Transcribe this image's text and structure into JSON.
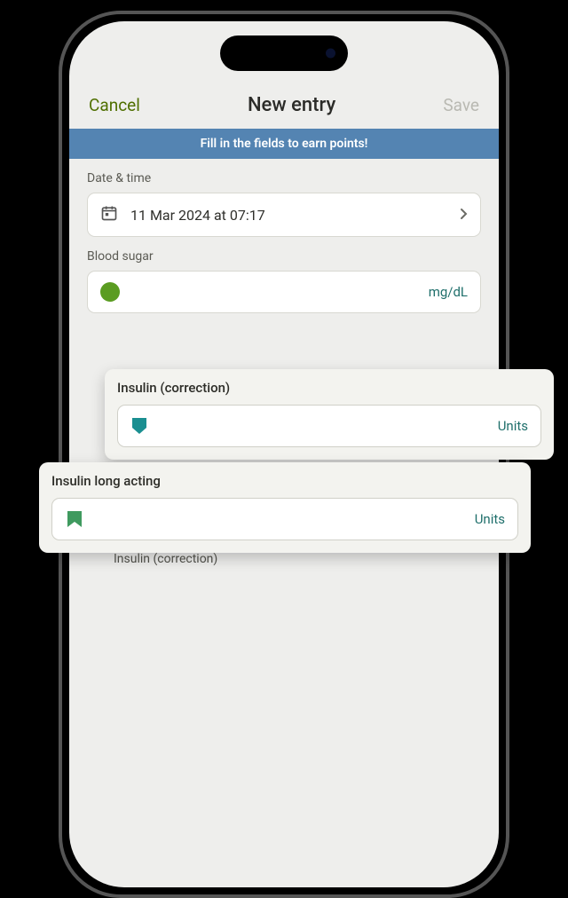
{
  "nav": {
    "cancel": "Cancel",
    "title": "New entry",
    "save": "Save"
  },
  "banner": "Fill in the fields to earn points!",
  "datetime": {
    "label": "Date & time",
    "value": "11 Mar 2024 at 07:17"
  },
  "blood_sugar": {
    "label": "Blood sugar",
    "unit": "mg/dL"
  },
  "overlay_correction": {
    "label": "Insulin (correction)",
    "unit": "Units"
  },
  "overlay_long_acting": {
    "label": "Insulin long acting",
    "unit": "Units"
  },
  "peek_label": "Insulin (correction)",
  "colors": {
    "accent_green": "#4f6f00",
    "banner_blue": "#5484b2",
    "teal": "#1f6f6b",
    "shield_teal": "#1a8f91",
    "bookmark_green": "#3f9a5f",
    "blood_green": "#5a9c21"
  }
}
